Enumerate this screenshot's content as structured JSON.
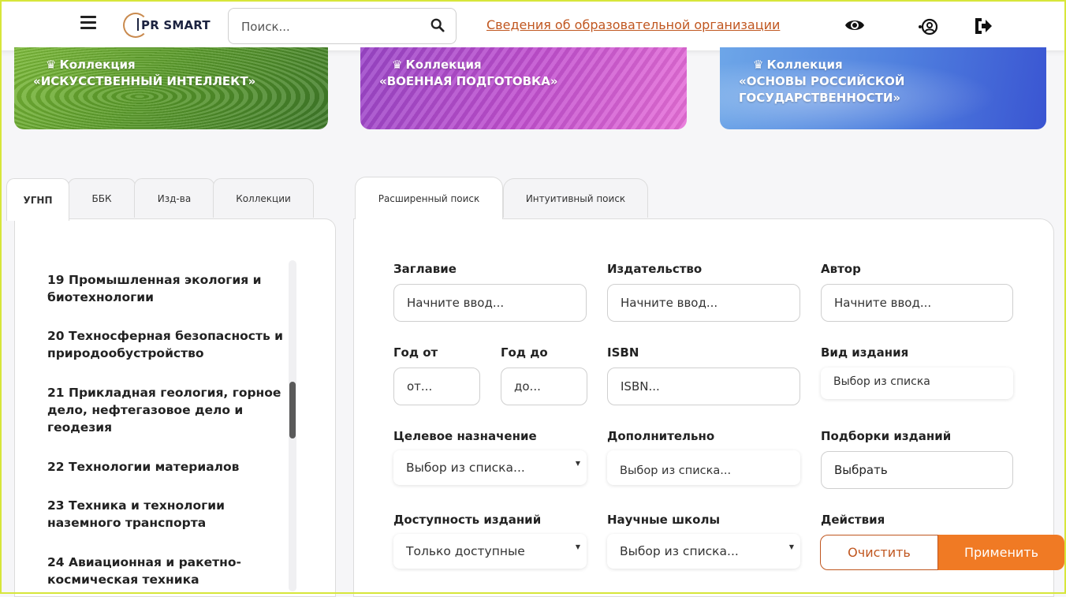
{
  "header": {
    "logo_text": "PR SMART",
    "search_placeholder": "Поиск...",
    "org_link": "Сведения об образовательной организации"
  },
  "banners": [
    {
      "label": "Коллекция",
      "title_lines": [
        "«ИСКУССТВЕННЫЙ ИНТЕЛЛЕКТ»"
      ]
    },
    {
      "label": "Коллекция",
      "title_lines": [
        "«ВОЕННАЯ ПОДГОТОВКА»"
      ]
    },
    {
      "label": "Коллекция",
      "title_lines": [
        "«ОСНОВЫ РОССИЙСКОЙ",
        "ГОСУДАРСТВЕННОСТИ»"
      ]
    }
  ],
  "left_tabs": [
    "УГНП",
    "ББК",
    "Изд-ва",
    "Коллекции"
  ],
  "categories": [
    "19 Промышленная экология и биотехнологии",
    "20 Техносферная безопасность и природообустройство",
    "21 Прикладная геология, горное дело, нефтегазовое дело и геодезия",
    "22 Технологии материалов",
    "23 Техника и технологии наземного транспорта",
    "24 Авиационная и ракетно-космическая техника"
  ],
  "search_tabs": [
    "Расширенный поиск",
    "Интуитивный поиск"
  ],
  "form": {
    "title_label": "Заглавие",
    "title_placeholder": "Начните ввод...",
    "publisher_label": "Издательство",
    "publisher_placeholder": "Начните ввод...",
    "author_label": "Автор",
    "author_placeholder": "Начните ввод...",
    "year_from_label": "Год от",
    "year_from_placeholder": "от...",
    "year_to_label": "Год до",
    "year_to_placeholder": "до...",
    "isbn_label": "ISBN",
    "isbn_placeholder": "ISBN...",
    "edition_type_label": "Вид издания",
    "edition_type_value": "Выбор из списка",
    "purpose_label": "Целевое назначение",
    "purpose_value": "Выбор из списка...",
    "additional_label": "Дополнительно",
    "additional_value": "Выбор из списка...",
    "collections_label": "Подборки изданий",
    "collections_value": "Выбрать",
    "availability_label": "Доступность изданий",
    "availability_value": "Только доступные",
    "schools_label": "Научные школы",
    "schools_value": "Выбор из списка...",
    "actions_label": "Действия",
    "clear_label": "Очистить",
    "apply_label": "Применить"
  },
  "colors": {
    "accent": "#f07a24",
    "link": "#c0561f"
  }
}
